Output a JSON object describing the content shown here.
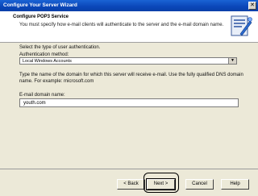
{
  "window": {
    "title": "Configure Your Server Wizard",
    "close_glyph": "✕"
  },
  "header": {
    "title": "Configure POP3 Service",
    "subtitle": "You must specify how e-mail clients will authenticate to the server and the e-mail domain name."
  },
  "form": {
    "intro": "Select the type of user authentication.",
    "auth_label": "Authentication method:",
    "auth_value": "Local Windows Accounts",
    "domain_help_line1": "Type the name of the domain for which this server will receive e-mail. Use the fully qualified DNS domain",
    "domain_help_line2": "name. For example: microsoft.com",
    "domain_label": "E-mail domain name:",
    "domain_value": "youth.com"
  },
  "buttons": {
    "back": "< Back",
    "next": "Next >",
    "cancel": "Cancel",
    "help": "Help"
  },
  "icons": {
    "wizard": "wizard-icon",
    "close": "close-icon",
    "dropdown": "chevron-down-icon"
  }
}
